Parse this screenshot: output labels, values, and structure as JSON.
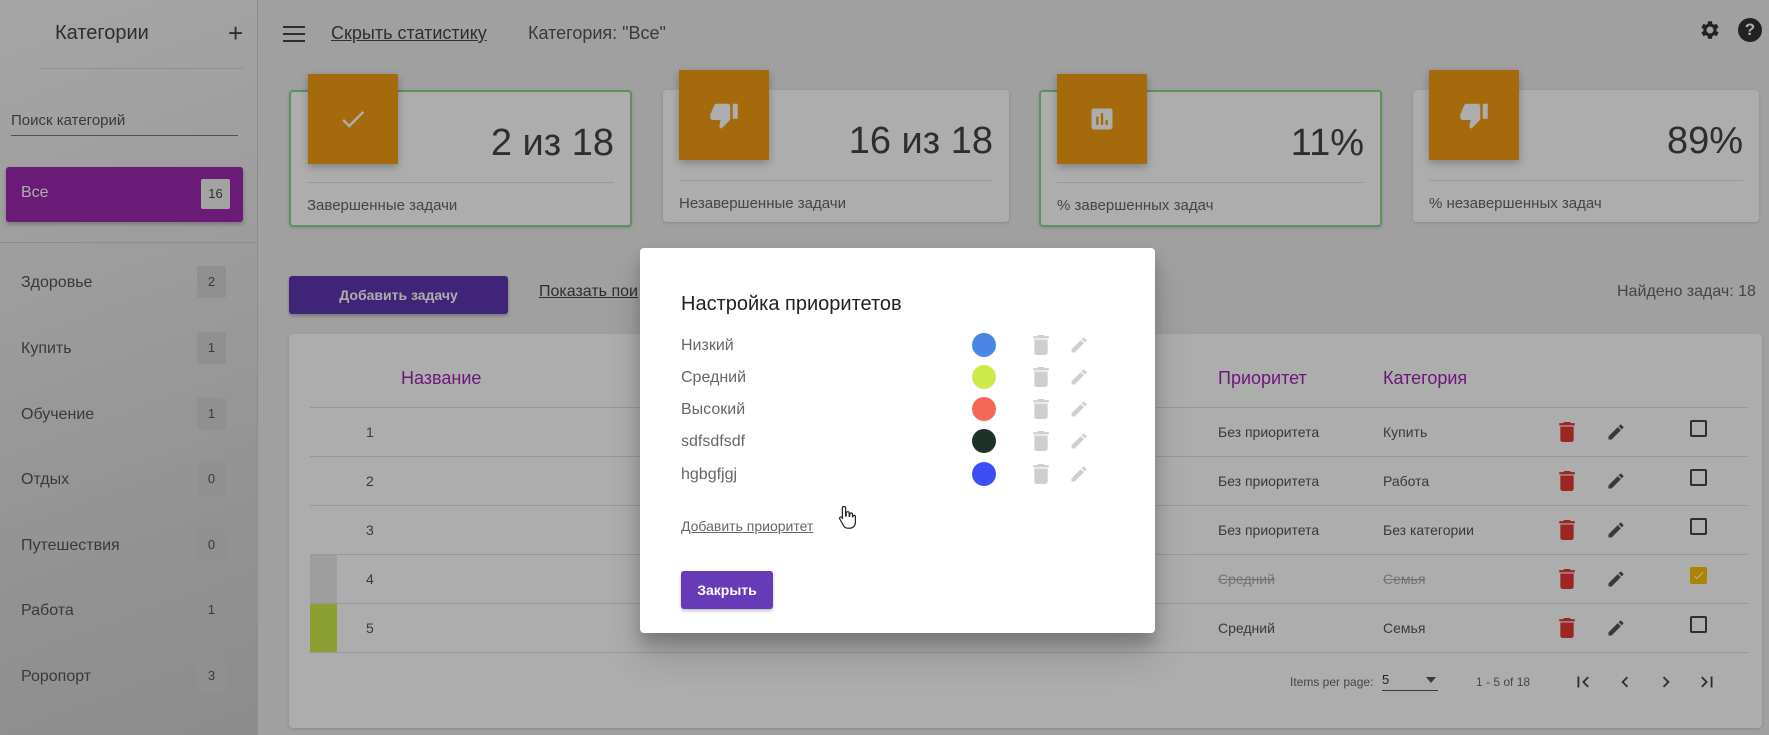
{
  "sidebar": {
    "title": "Категории",
    "add_icon": "plus-icon",
    "search_placeholder": "Поиск категорий",
    "all": {
      "label": "Все",
      "count": "16"
    },
    "items": [
      {
        "label": "Здоровье",
        "count": "2"
      },
      {
        "label": "Купить",
        "count": "1"
      },
      {
        "label": "Обучение",
        "count": "1"
      },
      {
        "label": "Отдых",
        "count": "0"
      },
      {
        "label": "Путешествия",
        "count": "0"
      },
      {
        "label": "Работа",
        "count": "1"
      },
      {
        "label": "Роропорт",
        "count": "3"
      }
    ]
  },
  "topbar": {
    "hide_stats": "Скрыть статистику",
    "category_label": "Категория: \"Все\""
  },
  "stats": [
    {
      "value": "2 из 18",
      "caption": "Завершенные задачи",
      "icon": "check-icon"
    },
    {
      "value": "16 из 18",
      "caption": "Незавершенные задачи",
      "icon": "thumb-down-icon"
    },
    {
      "value": "11%",
      "caption": "% завершенных задач",
      "icon": "chart-icon"
    },
    {
      "value": "89%",
      "caption": "% незавершенных задач",
      "icon": "thumb-down-icon"
    }
  ],
  "toolbar": {
    "add_task": "Добавить задачу",
    "show_search": "Показать пои",
    "found": "Найдено задач: 18"
  },
  "table": {
    "headers": {
      "name": "Название",
      "priority": "Приоритет",
      "category": "Категория"
    },
    "rows": [
      {
        "num": "1",
        "priority": "Без приоритета",
        "category": "Купить",
        "completed": false
      },
      {
        "num": "2",
        "priority": "Без приоритета",
        "category": "Работа",
        "completed": false
      },
      {
        "num": "3",
        "priority": "Без приоритета",
        "category": "Без категории",
        "completed": false
      },
      {
        "num": "4",
        "priority": "Средний",
        "category": "Семья",
        "completed": true
      },
      {
        "num": "5",
        "priority": "Средний",
        "category": "Семья",
        "completed": false
      }
    ]
  },
  "paginator": {
    "items_per_page_label": "Items per page:",
    "page_size": "5",
    "range": "1 - 5 of 18"
  },
  "dialog": {
    "title": "Настройка приоритетов",
    "priorities": [
      {
        "name": "Низкий",
        "color": "#4a86e8"
      },
      {
        "name": "Средний",
        "color": "#cdea4a"
      },
      {
        "name": "Высокий",
        "color": "#f4685a"
      },
      {
        "name": "sdfsdfsdf",
        "color": "#1e3328"
      },
      {
        "name": "hgbgfjgj",
        "color": "#3d4ef5"
      }
    ],
    "add_priority": "Добавить приоритет",
    "close": "Закрыть"
  },
  "colors": {
    "accent_purple": "#9c27b0",
    "button_purple": "#5e35b1",
    "tile_orange": "#f39c12",
    "highlight_green": "#8bd48e",
    "delete_red": "#e53935"
  }
}
